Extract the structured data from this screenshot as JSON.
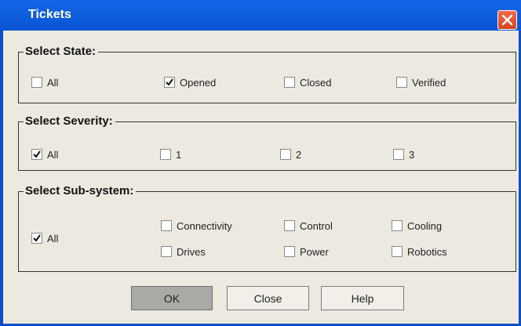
{
  "window": {
    "title": "Tickets"
  },
  "state": {
    "legend": "Select State:",
    "options": [
      {
        "label": "All",
        "checked": false
      },
      {
        "label": "Opened",
        "checked": true
      },
      {
        "label": "Closed",
        "checked": false
      },
      {
        "label": "Verified",
        "checked": false
      }
    ]
  },
  "severity": {
    "legend": "Select Severity:",
    "options": [
      {
        "label": "All",
        "checked": true
      },
      {
        "label": "1",
        "checked": false
      },
      {
        "label": "2",
        "checked": false
      },
      {
        "label": "3",
        "checked": false
      }
    ]
  },
  "subsystem": {
    "legend": "Select Sub-system:",
    "options": [
      {
        "label": "All",
        "checked": true
      },
      {
        "label": "Connectivity",
        "checked": false
      },
      {
        "label": "Control",
        "checked": false
      },
      {
        "label": "Cooling",
        "checked": false
      },
      {
        "label": "Drives",
        "checked": false
      },
      {
        "label": "Power",
        "checked": false
      },
      {
        "label": "Robotics",
        "checked": false
      }
    ]
  },
  "buttons": {
    "ok": "OK",
    "close": "Close",
    "help": "Help"
  }
}
